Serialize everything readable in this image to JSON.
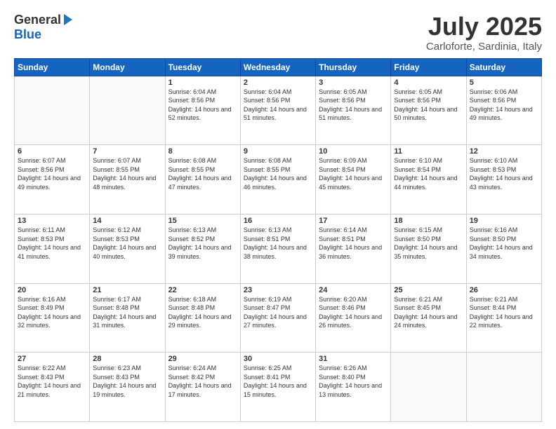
{
  "header": {
    "logo_general": "General",
    "logo_blue": "Blue",
    "month": "July 2025",
    "location": "Carloforte, Sardinia, Italy"
  },
  "weekdays": [
    "Sunday",
    "Monday",
    "Tuesday",
    "Wednesday",
    "Thursday",
    "Friday",
    "Saturday"
  ],
  "weeks": [
    [
      {
        "day": "",
        "info": ""
      },
      {
        "day": "",
        "info": ""
      },
      {
        "day": "1",
        "info": "Sunrise: 6:04 AM\nSunset: 8:56 PM\nDaylight: 14 hours\nand 52 minutes."
      },
      {
        "day": "2",
        "info": "Sunrise: 6:04 AM\nSunset: 8:56 PM\nDaylight: 14 hours\nand 51 minutes."
      },
      {
        "day": "3",
        "info": "Sunrise: 6:05 AM\nSunset: 8:56 PM\nDaylight: 14 hours\nand 51 minutes."
      },
      {
        "day": "4",
        "info": "Sunrise: 6:05 AM\nSunset: 8:56 PM\nDaylight: 14 hours\nand 50 minutes."
      },
      {
        "day": "5",
        "info": "Sunrise: 6:06 AM\nSunset: 8:56 PM\nDaylight: 14 hours\nand 49 minutes."
      }
    ],
    [
      {
        "day": "6",
        "info": "Sunrise: 6:07 AM\nSunset: 8:56 PM\nDaylight: 14 hours\nand 49 minutes."
      },
      {
        "day": "7",
        "info": "Sunrise: 6:07 AM\nSunset: 8:55 PM\nDaylight: 14 hours\nand 48 minutes."
      },
      {
        "day": "8",
        "info": "Sunrise: 6:08 AM\nSunset: 8:55 PM\nDaylight: 14 hours\nand 47 minutes."
      },
      {
        "day": "9",
        "info": "Sunrise: 6:08 AM\nSunset: 8:55 PM\nDaylight: 14 hours\nand 46 minutes."
      },
      {
        "day": "10",
        "info": "Sunrise: 6:09 AM\nSunset: 8:54 PM\nDaylight: 14 hours\nand 45 minutes."
      },
      {
        "day": "11",
        "info": "Sunrise: 6:10 AM\nSunset: 8:54 PM\nDaylight: 14 hours\nand 44 minutes."
      },
      {
        "day": "12",
        "info": "Sunrise: 6:10 AM\nSunset: 8:53 PM\nDaylight: 14 hours\nand 43 minutes."
      }
    ],
    [
      {
        "day": "13",
        "info": "Sunrise: 6:11 AM\nSunset: 8:53 PM\nDaylight: 14 hours\nand 41 minutes."
      },
      {
        "day": "14",
        "info": "Sunrise: 6:12 AM\nSunset: 8:53 PM\nDaylight: 14 hours\nand 40 minutes."
      },
      {
        "day": "15",
        "info": "Sunrise: 6:13 AM\nSunset: 8:52 PM\nDaylight: 14 hours\nand 39 minutes."
      },
      {
        "day": "16",
        "info": "Sunrise: 6:13 AM\nSunset: 8:51 PM\nDaylight: 14 hours\nand 38 minutes."
      },
      {
        "day": "17",
        "info": "Sunrise: 6:14 AM\nSunset: 8:51 PM\nDaylight: 14 hours\nand 36 minutes."
      },
      {
        "day": "18",
        "info": "Sunrise: 6:15 AM\nSunset: 8:50 PM\nDaylight: 14 hours\nand 35 minutes."
      },
      {
        "day": "19",
        "info": "Sunrise: 6:16 AM\nSunset: 8:50 PM\nDaylight: 14 hours\nand 34 minutes."
      }
    ],
    [
      {
        "day": "20",
        "info": "Sunrise: 6:16 AM\nSunset: 8:49 PM\nDaylight: 14 hours\nand 32 minutes."
      },
      {
        "day": "21",
        "info": "Sunrise: 6:17 AM\nSunset: 8:48 PM\nDaylight: 14 hours\nand 31 minutes."
      },
      {
        "day": "22",
        "info": "Sunrise: 6:18 AM\nSunset: 8:48 PM\nDaylight: 14 hours\nand 29 minutes."
      },
      {
        "day": "23",
        "info": "Sunrise: 6:19 AM\nSunset: 8:47 PM\nDaylight: 14 hours\nand 27 minutes."
      },
      {
        "day": "24",
        "info": "Sunrise: 6:20 AM\nSunset: 8:46 PM\nDaylight: 14 hours\nand 26 minutes."
      },
      {
        "day": "25",
        "info": "Sunrise: 6:21 AM\nSunset: 8:45 PM\nDaylight: 14 hours\nand 24 minutes."
      },
      {
        "day": "26",
        "info": "Sunrise: 6:21 AM\nSunset: 8:44 PM\nDaylight: 14 hours\nand 22 minutes."
      }
    ],
    [
      {
        "day": "27",
        "info": "Sunrise: 6:22 AM\nSunset: 8:43 PM\nDaylight: 14 hours\nand 21 minutes."
      },
      {
        "day": "28",
        "info": "Sunrise: 6:23 AM\nSunset: 8:43 PM\nDaylight: 14 hours\nand 19 minutes."
      },
      {
        "day": "29",
        "info": "Sunrise: 6:24 AM\nSunset: 8:42 PM\nDaylight: 14 hours\nand 17 minutes."
      },
      {
        "day": "30",
        "info": "Sunrise: 6:25 AM\nSunset: 8:41 PM\nDaylight: 14 hours\nand 15 minutes."
      },
      {
        "day": "31",
        "info": "Sunrise: 6:26 AM\nSunset: 8:40 PM\nDaylight: 14 hours\nand 13 minutes."
      },
      {
        "day": "",
        "info": ""
      },
      {
        "day": "",
        "info": ""
      }
    ]
  ]
}
